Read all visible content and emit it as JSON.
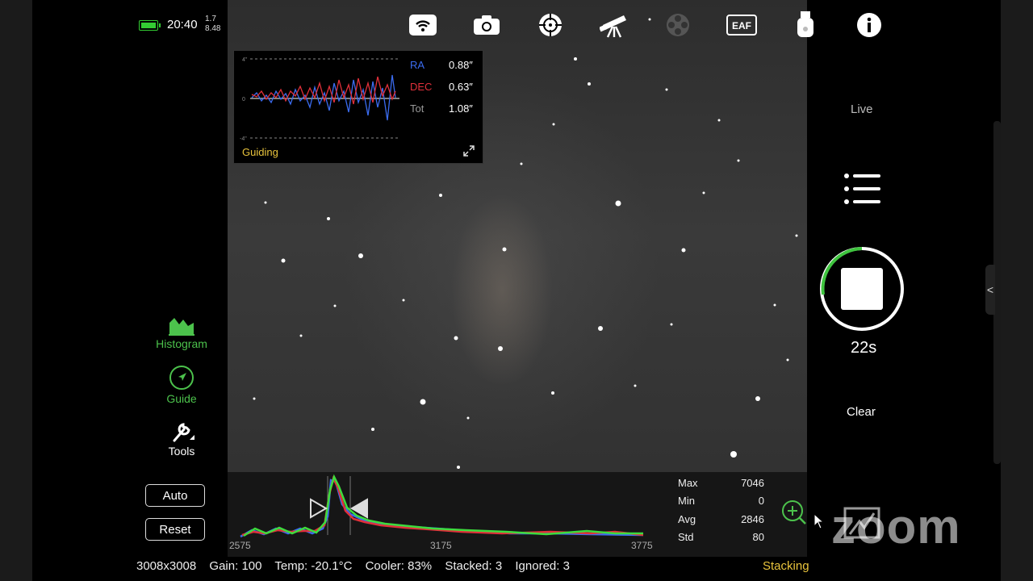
{
  "status": {
    "time": "20:40",
    "stat_top": "1.7",
    "stat_bottom": "8.48"
  },
  "top_icons": [
    "wifi-icon",
    "camera-icon",
    "focus-target-icon",
    "telescope-icon",
    "filter-wheel-icon",
    "eaf-icon",
    "usb-drive-icon",
    "info-icon"
  ],
  "eaf_label": "EAF",
  "guiding": {
    "title": "Guiding",
    "y_ticks": [
      "4\"",
      "0",
      "-4\""
    ],
    "ra_label": "RA",
    "ra_value": "0.88″",
    "dec_label": "DEC",
    "dec_value": "0.63″",
    "tot_label": "Tot",
    "tot_value": "1.08″",
    "colors": {
      "ra": "#3b6cf0",
      "dec": "#e0303a",
      "title": "#e9c43d"
    }
  },
  "tools": [
    {
      "name": "histogram",
      "label": "Histogram",
      "color": "#4cc24c"
    },
    {
      "name": "guide",
      "label": "Guide",
      "color": "#4cc24c"
    },
    {
      "name": "tools",
      "label": "Tools",
      "color": "#ffffff"
    }
  ],
  "buttons": {
    "auto": "Auto",
    "reset": "Reset"
  },
  "histogram": {
    "ticks": [
      "2575",
      "3175",
      "3775"
    ],
    "stats": [
      {
        "label": "Max",
        "value": "7046"
      },
      {
        "label": "Min",
        "value": "0"
      },
      {
        "label": "Avg",
        "value": "2846"
      },
      {
        "label": "Std",
        "value": "80"
      }
    ]
  },
  "info": {
    "resolution": "3008x3008",
    "gain": "Gain: 100",
    "temp": "Temp: -20.1°C",
    "cooler": "Cooler: 83%",
    "stacked": "Stacked: 3",
    "ignored": "Ignored: 3",
    "mode": "Stacking"
  },
  "right_panel": {
    "live": "Live",
    "timer": "22s",
    "clear": "Clear",
    "handle": "<"
  },
  "watermark": "zoom"
}
